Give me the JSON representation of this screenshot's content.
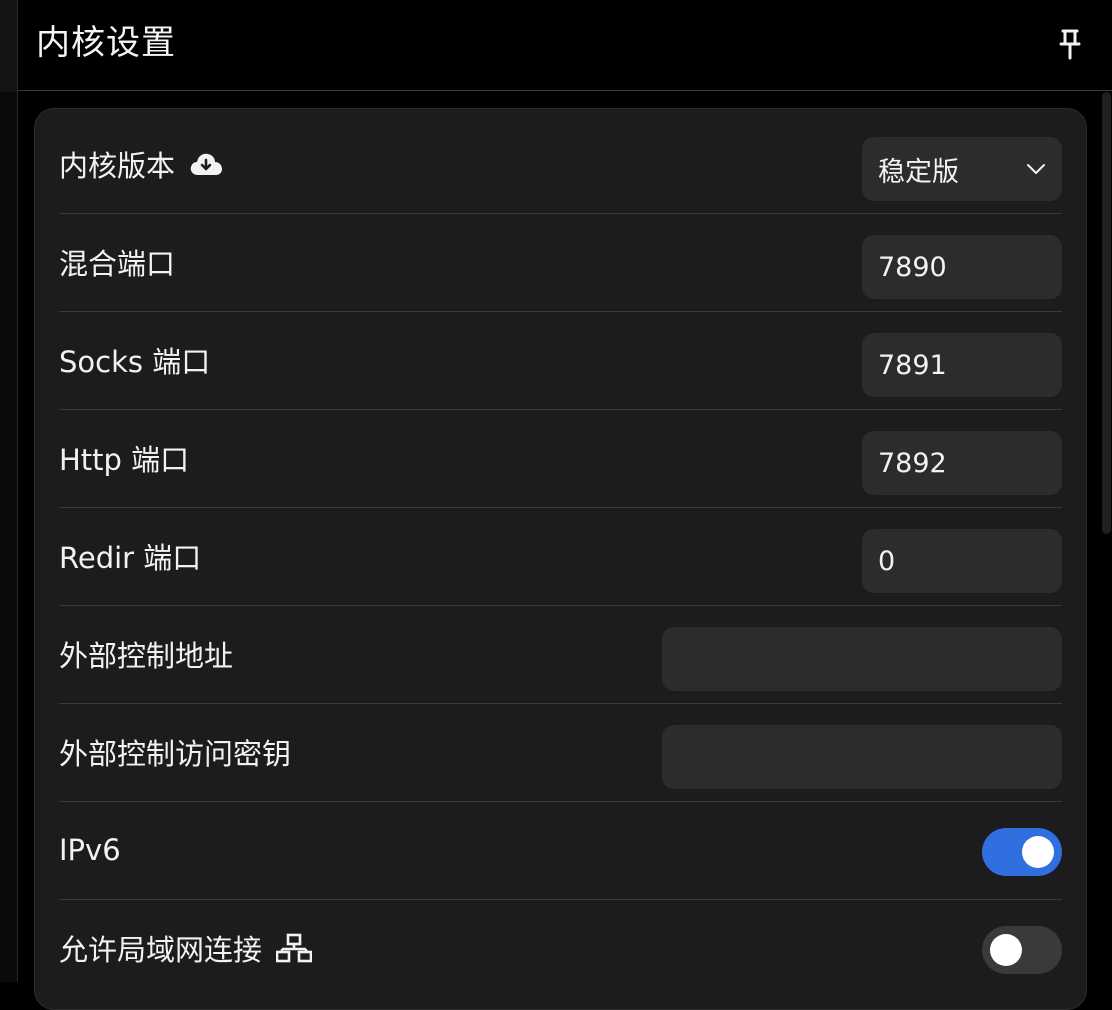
{
  "header": {
    "title": "内核设置",
    "pin_icon": "pin-icon"
  },
  "settings": {
    "core_version": {
      "label": "内核版本",
      "icon": "cloud-download-icon",
      "selected": "稳定版"
    },
    "mixed_port": {
      "label": "混合端口",
      "value": "7890"
    },
    "socks_port": {
      "label": "Socks 端口",
      "value": "7891"
    },
    "http_port": {
      "label": "Http 端口",
      "value": "7892"
    },
    "redir_port": {
      "label": "Redir 端口",
      "value": "0"
    },
    "external_controller": {
      "label": "外部控制地址",
      "value": ""
    },
    "external_secret": {
      "label": "外部控制访问密钥",
      "value": ""
    },
    "ipv6": {
      "label": "IPv6",
      "enabled": true
    },
    "allow_lan": {
      "label": "允许局域网连接",
      "icon": "network-icon",
      "enabled": false
    }
  },
  "colors": {
    "accent": "#2f6fdf",
    "panel": "#1c1c1e",
    "field": "#2c2c2e"
  }
}
